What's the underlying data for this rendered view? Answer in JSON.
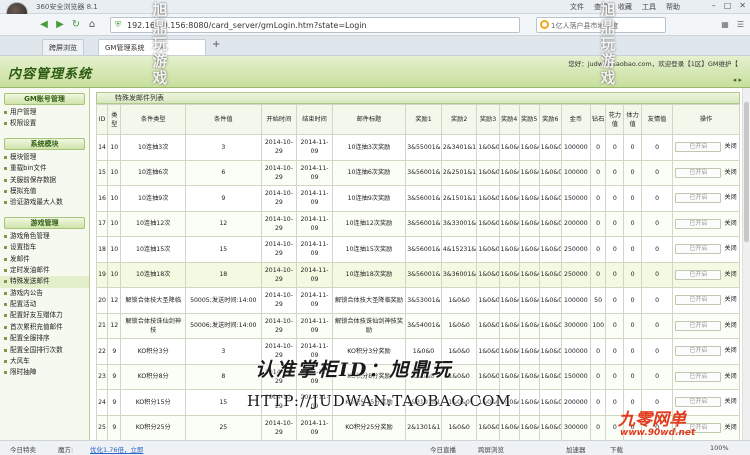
{
  "browser": {
    "title": "360安全浏览器 8.1",
    "menu": [
      "文件",
      "查看",
      "收藏",
      "工具",
      "帮助"
    ],
    "url": "192.168.0.156:8080/card_server/gmLogin.htm?state=Login",
    "search_text": "1亿人落户县市地制度",
    "tabs": [
      {
        "label": "跨屏浏览"
      },
      {
        "label": "GM管理系统"
      }
    ],
    "new_tab": "+"
  },
  "header": {
    "title": "内容管理系统",
    "welcome": "您好：judwan.taobao.com，欢迎登录【1区】GM维护【",
    "arrows": "◂ ▸"
  },
  "sidebar": {
    "sections": [
      {
        "title": "GM账号管理",
        "items": [
          "用户管理",
          "权限设置"
        ]
      },
      {
        "title": "系统模块",
        "items": [
          "模块管理",
          "重载bin文件",
          "关服前保存数据",
          "模拟充值",
          "验证游戏最大人数"
        ]
      },
      {
        "title": "游戏管理",
        "items": [
          "游戏角色管理",
          "设置指车",
          "发邮件",
          "定时发油邮件",
          "特殊发送邮件",
          "游戏内公告",
          "配置活动",
          "配置好友互赠体力",
          "首次累积充值邮件",
          "配置全服排序",
          "配置全国排行次数",
          "大风车",
          "限时抽陣"
        ]
      }
    ]
  },
  "table": {
    "panel_title": "特殊发邮件列表",
    "columns": [
      "ID",
      "类型",
      "条件类型",
      "条件值",
      "开始时间",
      "结束时间",
      "邮件标题",
      "奖励1",
      "奖励2",
      "奖励3",
      "奖励4",
      "奖励5",
      "奖励6",
      "金币",
      "钻石",
      "花力值",
      "体力值",
      "友情值",
      "操作"
    ],
    "open_label": "已开启",
    "close_label": "关闭",
    "rows": [
      {
        "id": "14",
        "type": "10",
        "ctype": "10连抽3次",
        "cval": "3",
        "start": "2014-10-29",
        "end": "2014-11-09",
        "title": "10连抽3次奖励",
        "r1": "3&55001&5",
        "r2": "2&3401&1",
        "r3": "1&0&0",
        "r4": "1&0&0",
        "r5": "1&0&0",
        "r6": "1&0&0",
        "gold": "100000",
        "diamond": "0",
        "flower": "0",
        "stamina": "0",
        "friend": "0"
      },
      {
        "id": "15",
        "type": "10",
        "ctype": "10连抽6次",
        "cval": "6",
        "start": "2014-10-29",
        "end": "2014-11-09",
        "title": "10连抽6次奖励",
        "r1": "3&56001&6",
        "r2": "2&2501&1",
        "r3": "1&0&0",
        "r4": "1&0&0",
        "r5": "1&0&0",
        "r6": "1&0&0",
        "gold": "100000",
        "diamond": "0",
        "flower": "0",
        "stamina": "0",
        "friend": "0"
      },
      {
        "id": "16",
        "type": "10",
        "ctype": "10连抽9次",
        "cval": "9",
        "start": "2014-10-29",
        "end": "2014-11-09",
        "title": "10连抽9次奖励",
        "r1": "3&56001&9",
        "r2": "2&1501&1",
        "r3": "1&0&0",
        "r4": "1&0&0",
        "r5": "1&0&0",
        "r6": "1&0&0",
        "gold": "150000",
        "diamond": "0",
        "flower": "0",
        "stamina": "0",
        "friend": "0"
      },
      {
        "id": "17",
        "type": "10",
        "ctype": "10连抽12次",
        "cval": "12",
        "start": "2014-10-29",
        "end": "2014-11-09",
        "title": "10连抽12次奖励",
        "r1": "3&56001&12",
        "r2": "3&33001&1",
        "r3": "1&0&0",
        "r4": "1&0&0",
        "r5": "1&0&0",
        "r6": "1&0&0",
        "gold": "200000",
        "diamond": "0",
        "flower": "0",
        "stamina": "0",
        "friend": "0"
      },
      {
        "id": "18",
        "type": "10",
        "ctype": "10连抽15次",
        "cval": "15",
        "start": "2014-10-29",
        "end": "2014-11-09",
        "title": "10连抽15次奖励",
        "r1": "3&56001&15",
        "r2": "4&15231&1",
        "r3": "1&0&0",
        "r4": "1&0&0",
        "r5": "1&0&0",
        "r6": "1&0&0",
        "gold": "250000",
        "diamond": "0",
        "flower": "0",
        "stamina": "0",
        "friend": "0"
      },
      {
        "id": "19",
        "type": "10",
        "ctype": "10连抽18次",
        "cval": "18",
        "start": "2014-10-29",
        "end": "2014-11-09",
        "title": "10连抽18次奖励",
        "r1": "3&56001&18",
        "r2": "3&36001&1",
        "r3": "1&0&0",
        "r4": "1&0&0",
        "r5": "1&0&0",
        "r6": "1&0&0",
        "gold": "250000",
        "diamond": "0",
        "flower": "0",
        "stamina": "0",
        "friend": "0"
      },
      {
        "id": "20",
        "type": "12",
        "ctype": "解锁合体技大圣降临",
        "cval": "50005;发送时间:14:00",
        "start": "2014-10-29",
        "end": "2014-11-09",
        "title": "解锁合体技大圣降临奖励",
        "r1": "3&53001&5",
        "r2": "1&0&0",
        "r3": "1&0&0",
        "r4": "1&0&0",
        "r5": "1&0&0",
        "r6": "1&0&0",
        "gold": "100000",
        "diamond": "50",
        "flower": "0",
        "stamina": "0",
        "friend": "0"
      },
      {
        "id": "21",
        "type": "12",
        "ctype": "解锁合体技诛仙剑神技",
        "cval": "50006;发送时间:14:00",
        "start": "2014-10-29",
        "end": "2014-11-09",
        "title": "解锁合体技诛仙剑神技奖励",
        "r1": "3&54001&5",
        "r2": "1&0&0",
        "r3": "1&0&0",
        "r4": "1&0&0",
        "r5": "1&0&0",
        "r6": "1&0&0",
        "gold": "300000",
        "diamond": "100",
        "flower": "0",
        "stamina": "0",
        "friend": "0"
      },
      {
        "id": "22",
        "type": "9",
        "ctype": "KO积分3分",
        "cval": "3",
        "start": "2014-10-29",
        "end": "2014-11-09",
        "title": "KO积分3分奖励",
        "r1": "1&0&0",
        "r2": "1&0&0",
        "r3": "1&0&0",
        "r4": "1&0&0",
        "r5": "1&0&0",
        "r6": "1&0&0",
        "gold": "100000",
        "diamond": "0",
        "flower": "0",
        "stamina": "0",
        "friend": "0"
      },
      {
        "id": "23",
        "type": "9",
        "ctype": "KO积分8分",
        "cval": "8",
        "start": "2014-10-29",
        "end": "2014-11-09",
        "title": "KO积分8分奖励",
        "r1": "1&0&0",
        "r2": "1&0&0",
        "r3": "1&0&0",
        "r4": "1&0&0",
        "r5": "1&0&0",
        "r6": "1&0&0",
        "gold": "150000",
        "diamond": "0",
        "flower": "0",
        "stamina": "0",
        "friend": "0"
      },
      {
        "id": "24",
        "type": "9",
        "ctype": "KO积分15分",
        "cval": "15",
        "start": "2014-10-29",
        "end": "2014-11-09",
        "title": "KO积分15分奖励",
        "r1": "2&3101&1",
        "r2": "1&0&0",
        "r3": "1&0&0",
        "r4": "1&0&0",
        "r5": "1&0&0",
        "r6": "1&0&0",
        "gold": "200000",
        "diamond": "0",
        "flower": "0",
        "stamina": "0",
        "friend": "0"
      },
      {
        "id": "25",
        "type": "9",
        "ctype": "KO积分25分",
        "cval": "25",
        "start": "2014-10-29",
        "end": "2014-11-09",
        "title": "KO积分25分奖励",
        "r1": "2&1301&1",
        "r2": "1&0&0",
        "r3": "1&0&0",
        "r4": "1&0&0",
        "r5": "1&0&0",
        "r6": "1&0&0",
        "gold": "300000",
        "diamond": "0",
        "flower": "0",
        "stamina": "0",
        "friend": "0"
      },
      {
        "id": "",
        "type": "",
        "ctype": "",
        "cval": "",
        "start": "2014-10-2",
        "end": "2014-10-3",
        "title": "10月29日充值30元奖",
        "r1": "3&90009&",
        "r2": "",
        "r3": "",
        "r4": "",
        "r5": "",
        "r6": "",
        "gold": "",
        "diamond": "",
        "flower": "",
        "stamina": "",
        "friend": ""
      }
    ]
  },
  "statusbar": {
    "left1": "今日特卖",
    "left2": "魔方:",
    "left3": "优化1.76倍，立即",
    "right1": "今日直播",
    "right2": "跨屏浏览",
    "right3": "加速器",
    "right4": "下载",
    "right5": "100%"
  },
  "watermark": {
    "line1": "认准掌柜ID：旭鼎玩",
    "line2": "HTTP://JUDWAN.TAOBAO.COM",
    "vert_left": "旭鼎玩游戏",
    "vert_right": "旭鼎玩游戏",
    "site_logo": "九零网单",
    "site_url": "www.90wd.net"
  }
}
